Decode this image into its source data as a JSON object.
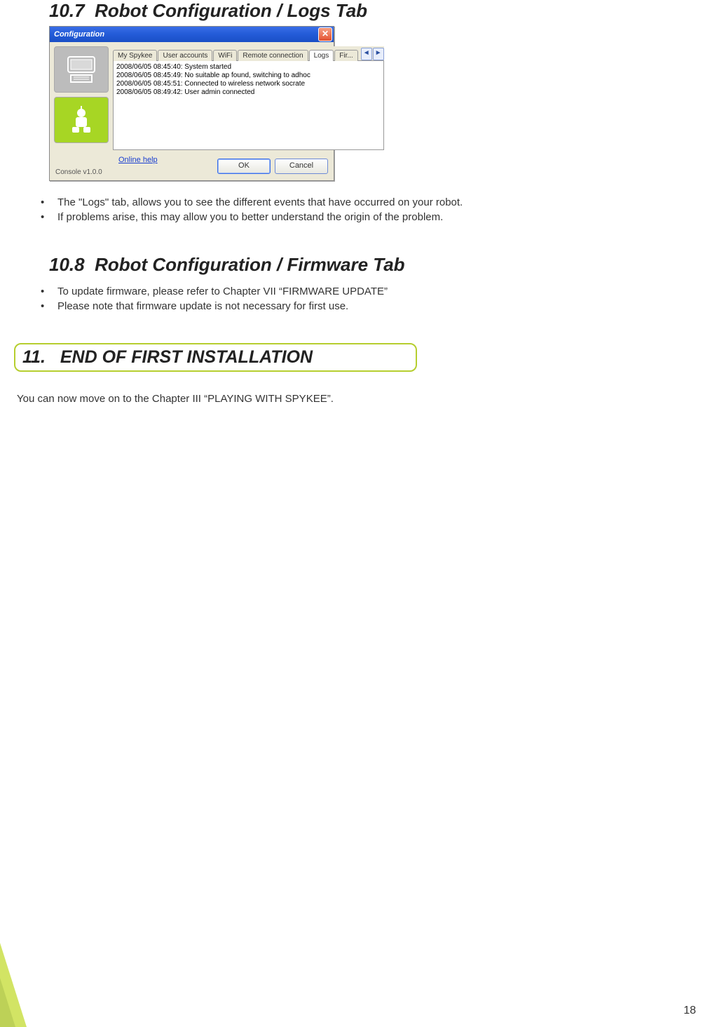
{
  "sections": {
    "s107": {
      "num": "10.7",
      "title": "Robot Configuration / Logs Tab"
    },
    "s108": {
      "num": "10.8",
      "title": "Robot Configuration / Firmware Tab"
    },
    "s11": {
      "num": "11.",
      "title": "END OF FIRST INSTALLATION"
    }
  },
  "window": {
    "title": "Configuration",
    "tabs": [
      "My Spykee",
      "User accounts",
      "WiFi",
      "Remote connection",
      "Logs",
      "Fir..."
    ],
    "active_tab_index": 4,
    "logs": [
      "2008/06/05 08:45:40: System started",
      "2008/06/05 08:45:49: No suitable ap found, switching to adhoc",
      "2008/06/05 08:45:51: Connected to wireless network socrate",
      "2008/06/05 08:49:42: User admin connected"
    ],
    "help_link": "Online help",
    "console": "Console v1.0.0",
    "ok": "OK",
    "cancel": "Cancel",
    "scroll_left": "◄",
    "scroll_right": "►",
    "close": "✕"
  },
  "list107": [
    "The \"Logs\" tab, allows you to see the different events that have occurred on your robot.",
    "If problems arise, this may allow you to better understand the origin of the problem."
  ],
  "list108": [
    "To update firmware, please refer to Chapter VII “FIRMWARE UPDATE”",
    "Please note that firmware update is not necessary for first use."
  ],
  "closing": "You can now move on to the Chapter III “PLAYING WITH SPYKEE”.",
  "page_number": "18"
}
